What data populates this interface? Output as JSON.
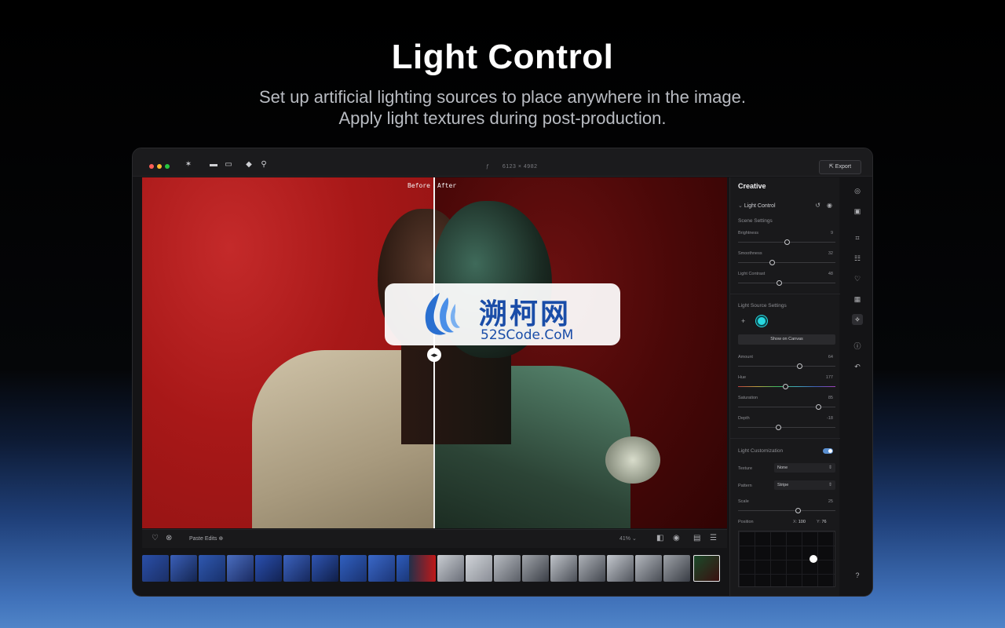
{
  "hero": {
    "title": "Light Control",
    "subtitle_line1": "Set up artificial lighting sources to place anywhere in the image.",
    "subtitle_line2": "Apply light textures during post-production."
  },
  "titlebar": {
    "dimensions": "6123 × 4982",
    "export_label": "Export"
  },
  "canvas": {
    "before_label": "Before",
    "after_label": "After"
  },
  "bottombar": {
    "paste_label": "Paste Edits",
    "zoom": "41%"
  },
  "panel": {
    "title": "Creative",
    "tool_name": "Light Control",
    "scene_settings": "Scene Settings",
    "brightness": {
      "label": "Brightness",
      "value": "9",
      "fraction": 0.5
    },
    "smoothness": {
      "label": "Smoothness",
      "value": "32",
      "fraction": 0.34
    },
    "light_contrast": {
      "label": "Light Contrast",
      "value": "48",
      "fraction": 0.42
    },
    "light_source_settings": "Light Source Settings",
    "show_on_canvas": "Show on Canvas",
    "amount": {
      "label": "Amount",
      "value": "64",
      "fraction": 0.64
    },
    "hue": {
      "label": "Hue",
      "value": "177",
      "fraction": 0.49
    },
    "saturation": {
      "label": "Saturation",
      "value": "85",
      "fraction": 0.85
    },
    "depth": {
      "label": "Depth",
      "value": "-18",
      "fraction": 0.41
    },
    "light_customization": "Light Customization",
    "texture": {
      "label": "Texture",
      "value": "None"
    },
    "pattern": {
      "label": "Pattern",
      "value": "Stripe"
    },
    "scale": {
      "label": "Scale",
      "value": "25",
      "fraction": 0.62
    },
    "position": {
      "label": "Position",
      "x_label": "X",
      "x_value": "100",
      "y_label": "Y",
      "y_value": "76"
    }
  },
  "watermark": {
    "cn": "溯柯网",
    "en": "52SCode.CoM"
  },
  "colors": {
    "accent": "#28d8e0",
    "toggle": "#5a8fd0",
    "watermark_blue": "#1a4da8"
  }
}
